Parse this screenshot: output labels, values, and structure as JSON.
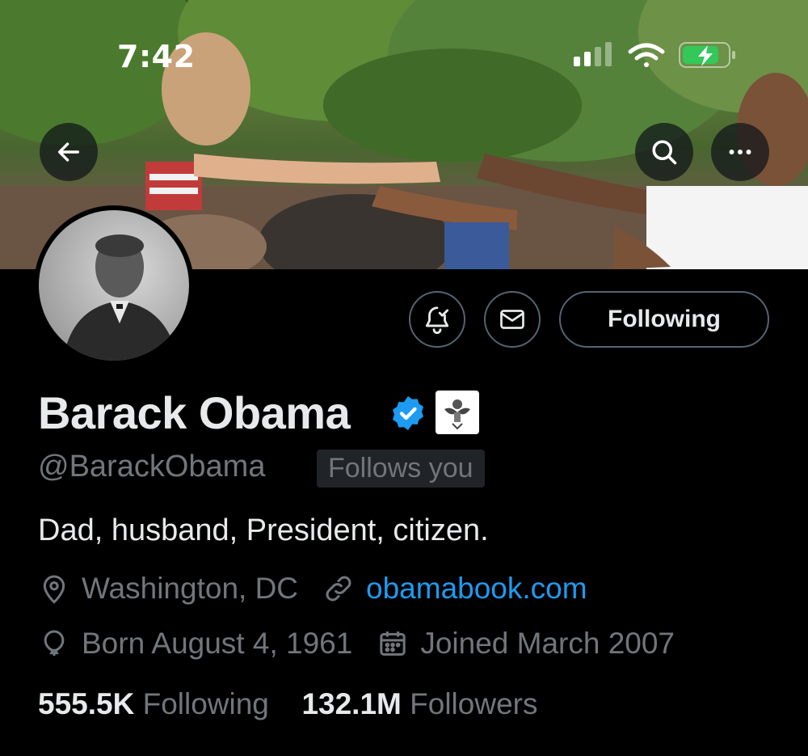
{
  "status_bar": {
    "time": "7:42"
  },
  "header": {
    "back_icon": "arrow-left-icon",
    "search_icon": "search-icon",
    "more_icon": "ellipsis-icon"
  },
  "actions": {
    "notifications_icon": "bell-check-icon",
    "message_icon": "mail-icon",
    "following_label": "Following"
  },
  "profile": {
    "name": "Barack Obama",
    "handle": "@BarackObama",
    "follows_you": "Follows you",
    "bio": "Dad, husband, President, citizen.",
    "location": "Washington, DC",
    "website": "obamabook.com",
    "birthday": "Born August 4, 1961",
    "joined": "Joined March 2007",
    "following_count": "555.5K",
    "following_label": "Following",
    "followers_count": "132.1M",
    "followers_label": "Followers"
  },
  "colors": {
    "accent": "#1d9bf0",
    "muted": "#71767b",
    "text": "#e7e9ea",
    "background": "#000000"
  }
}
